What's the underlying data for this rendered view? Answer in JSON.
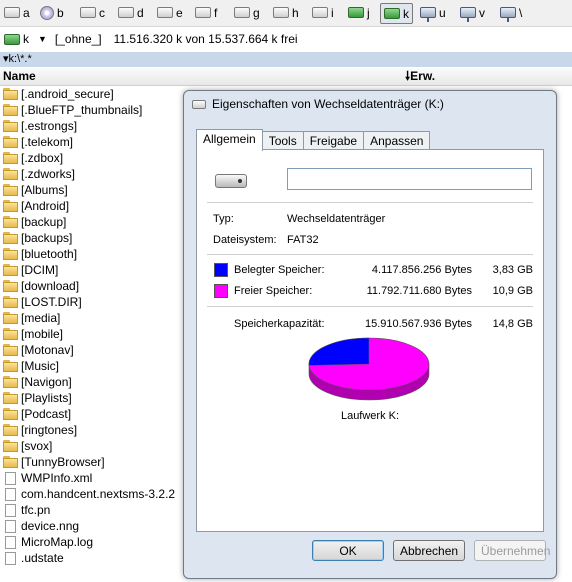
{
  "drivebar": {
    "drives": [
      {
        "letter": "a",
        "icon": "floppy-drive-icon"
      },
      {
        "letter": "b",
        "icon": "cd-drive-icon"
      },
      {
        "letter": "c",
        "icon": "hard-drive-icon"
      },
      {
        "letter": "d",
        "icon": "hard-drive-icon"
      },
      {
        "letter": "e",
        "icon": "hard-drive-icon"
      },
      {
        "letter": "f",
        "icon": "hard-drive-icon"
      },
      {
        "letter": "g",
        "icon": "hard-drive-icon"
      },
      {
        "letter": "h",
        "icon": "hard-drive-icon"
      },
      {
        "letter": "i",
        "icon": "hard-drive-icon"
      },
      {
        "letter": "j",
        "icon": "usb-drive-icon"
      },
      {
        "letter": "k",
        "icon": "usb-drive-icon"
      },
      {
        "letter": "u",
        "icon": "network-drive-icon"
      },
      {
        "letter": "v",
        "icon": "network-drive-icon"
      },
      {
        "letter": "\\",
        "icon": "network-root-icon"
      }
    ],
    "active": "k"
  },
  "inforow": {
    "current_drive": "k",
    "label": "[_ohne_]",
    "free_text": "11.516.320 k von 15.537.664 k frei"
  },
  "path": "k:\\*.*",
  "columns": {
    "name": "Name",
    "ext": "Erw."
  },
  "files": [
    {
      "name": "[.android_secure]",
      "type": "folder"
    },
    {
      "name": "[.BlueFTP_thumbnails]",
      "type": "folder"
    },
    {
      "name": "[.estrongs]",
      "type": "folder"
    },
    {
      "name": "[.telekom]",
      "type": "folder"
    },
    {
      "name": "[.zdbox]",
      "type": "folder"
    },
    {
      "name": "[.zdworks]",
      "type": "folder"
    },
    {
      "name": "[Albums]",
      "type": "folder"
    },
    {
      "name": "[Android]",
      "type": "folder"
    },
    {
      "name": "[backup]",
      "type": "folder"
    },
    {
      "name": "[backups]",
      "type": "folder"
    },
    {
      "name": "[bluetooth]",
      "type": "folder"
    },
    {
      "name": "[DCIM]",
      "type": "folder"
    },
    {
      "name": "[download]",
      "type": "folder"
    },
    {
      "name": "[LOST.DIR]",
      "type": "folder"
    },
    {
      "name": "[media]",
      "type": "folder"
    },
    {
      "name": "[mobile]",
      "type": "folder"
    },
    {
      "name": "[Motonav]",
      "type": "folder"
    },
    {
      "name": "[Music]",
      "type": "folder"
    },
    {
      "name": "[Navigon]",
      "type": "folder"
    },
    {
      "name": "[Playlists]",
      "type": "folder"
    },
    {
      "name": "[Podcast]",
      "type": "folder"
    },
    {
      "name": "[ringtones]",
      "type": "folder"
    },
    {
      "name": "[svox]",
      "type": "folder"
    },
    {
      "name": "[TunnyBrowser]",
      "type": "folder"
    },
    {
      "name": "WMPInfo.xml",
      "type": "file"
    },
    {
      "name": "com.handcent.nextsms-3.2.2",
      "type": "file"
    },
    {
      "name": "tfc.pn",
      "type": "file"
    },
    {
      "name": "device.nng",
      "type": "file"
    },
    {
      "name": "MicroMap.log",
      "type": "file"
    },
    {
      "name": ".udstate",
      "type": "file"
    }
  ],
  "dialog": {
    "title": "Eigenschaften von Wechseldatenträger (K:)",
    "tabs": [
      "Allgemein",
      "Tools",
      "Freigabe",
      "Anpassen"
    ],
    "name_value": "",
    "type_label": "Typ:",
    "type_value": "Wechseldatenträger",
    "fs_label": "Dateisystem:",
    "fs_value": "FAT32",
    "used_label": "Belegter Speicher:",
    "used_bytes": "4.117.856.256 Bytes",
    "used_gb": "3,83 GB",
    "free_label": "Freier Speicher:",
    "free_bytes": "11.792.711.680 Bytes",
    "free_gb": "10,9 GB",
    "cap_label": "Speicherkapazität:",
    "cap_bytes": "15.910.567.936 Bytes",
    "cap_gb": "14,8 GB",
    "drive_label": "Laufwerk K:",
    "ok": "OK",
    "cancel": "Abbrechen",
    "apply": "Übernehmen",
    "colors": {
      "used": "#0000ff",
      "free": "#ff00ff"
    },
    "used_fraction": 0.2588
  }
}
